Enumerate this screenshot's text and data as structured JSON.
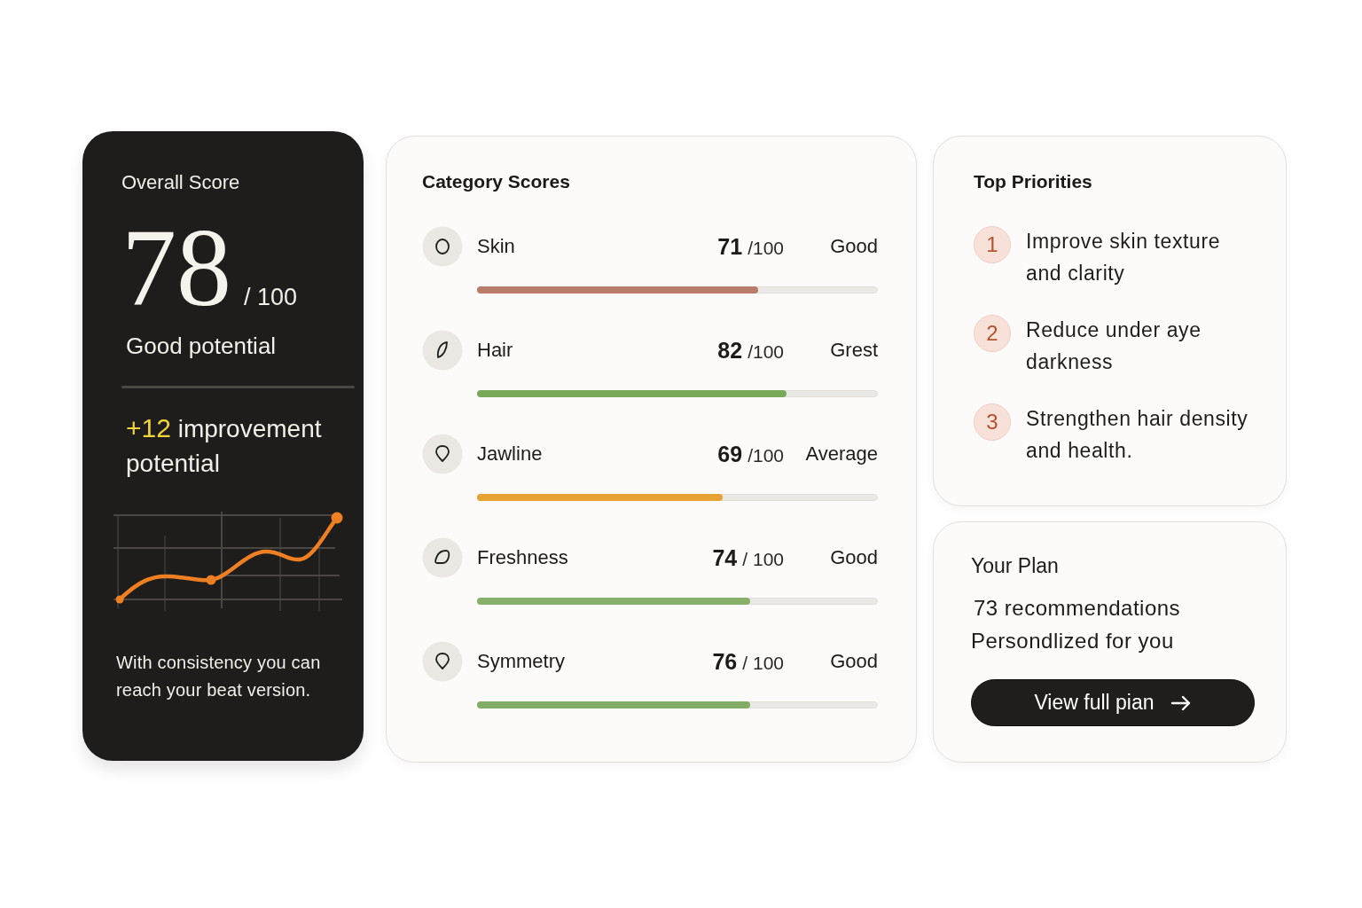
{
  "overall": {
    "title": "Overall Score",
    "score": "78",
    "max": "/ 100",
    "rating": "Good potential",
    "improvement": {
      "value": "+12",
      "label": "improvement potential"
    },
    "note": "With consistency you can reach your beat version."
  },
  "categories": {
    "title": "Category Scores",
    "items": [
      {
        "name": "Skin",
        "score": "71",
        "max": "/100",
        "status": "Good",
        "level": 0.7,
        "color": "#b97c6a"
      },
      {
        "name": "Hair",
        "score": "82",
        "max": "/100",
        "status": "Grest",
        "level": 0.77,
        "color": "#78a85a"
      },
      {
        "name": "Jawline",
        "score": "69",
        "max": "/100",
        "status": "Average",
        "level": 0.61,
        "color": "#e6a233"
      },
      {
        "name": "Freshness",
        "score": "74",
        "max": "/ 100",
        "status": "Good",
        "level": 0.68,
        "color": "#88b06b"
      },
      {
        "name": "Symmetry",
        "score": "76",
        "max": "/ 100",
        "status": "Good",
        "level": 0.68,
        "color": "#82ad64"
      }
    ]
  },
  "priorities": {
    "title": "Top Priorities",
    "items": [
      {
        "number": "1",
        "text": "Improve skin texture and clarity"
      },
      {
        "number": "2",
        "text": "Reduce under aye darkness"
      },
      {
        "number": "3",
        "text": "Strengthen hair density and health."
      }
    ]
  },
  "plan": {
    "title": "Your Plan",
    "count": "73 recommendations",
    "subtitle": "Persondlized for you",
    "button": "View full pian"
  }
}
